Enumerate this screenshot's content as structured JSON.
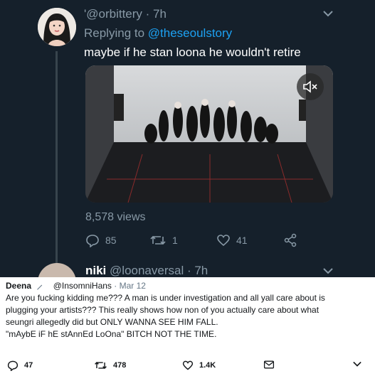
{
  "tweet": {
    "handle": "'@orbittery",
    "time": "· 7h",
    "replying_prefix": "Replying to",
    "replying_to": "@theseoulstory",
    "text": "maybe if he stan loona he wouldn't retire",
    "views": "8,578 views",
    "replies": "85",
    "retweets": "1",
    "likes": "41"
  },
  "next_tweet": {
    "name": "niki",
    "handle": "@loonaversal",
    "time": "· 7h"
  },
  "quoted": {
    "name": "Deena",
    "handle": "@InsomniHans",
    "date": "· Mar 12",
    "text": "Are you fucking kidding me??? A man is under investigation and all yall care about is\nplugging your artists??? This really shows how non of you actually care about what\nseungri allegedly did but ONLY WANNA SEE HIM FALL.\n\"mAybE iF hE stAnnEd LoOna\" BITCH NOT THE TIME.",
    "replies": "47",
    "retweets": "478",
    "likes": "1.4K"
  },
  "colors": {
    "background": "#15202b",
    "accent": "#1da1f2",
    "muted": "#8899a6",
    "light_background": "#ffffff"
  },
  "icons": [
    "reply-icon",
    "retweet-icon",
    "like-icon",
    "share-icon",
    "mute-icon",
    "chevron-down-icon",
    "mail-icon"
  ]
}
